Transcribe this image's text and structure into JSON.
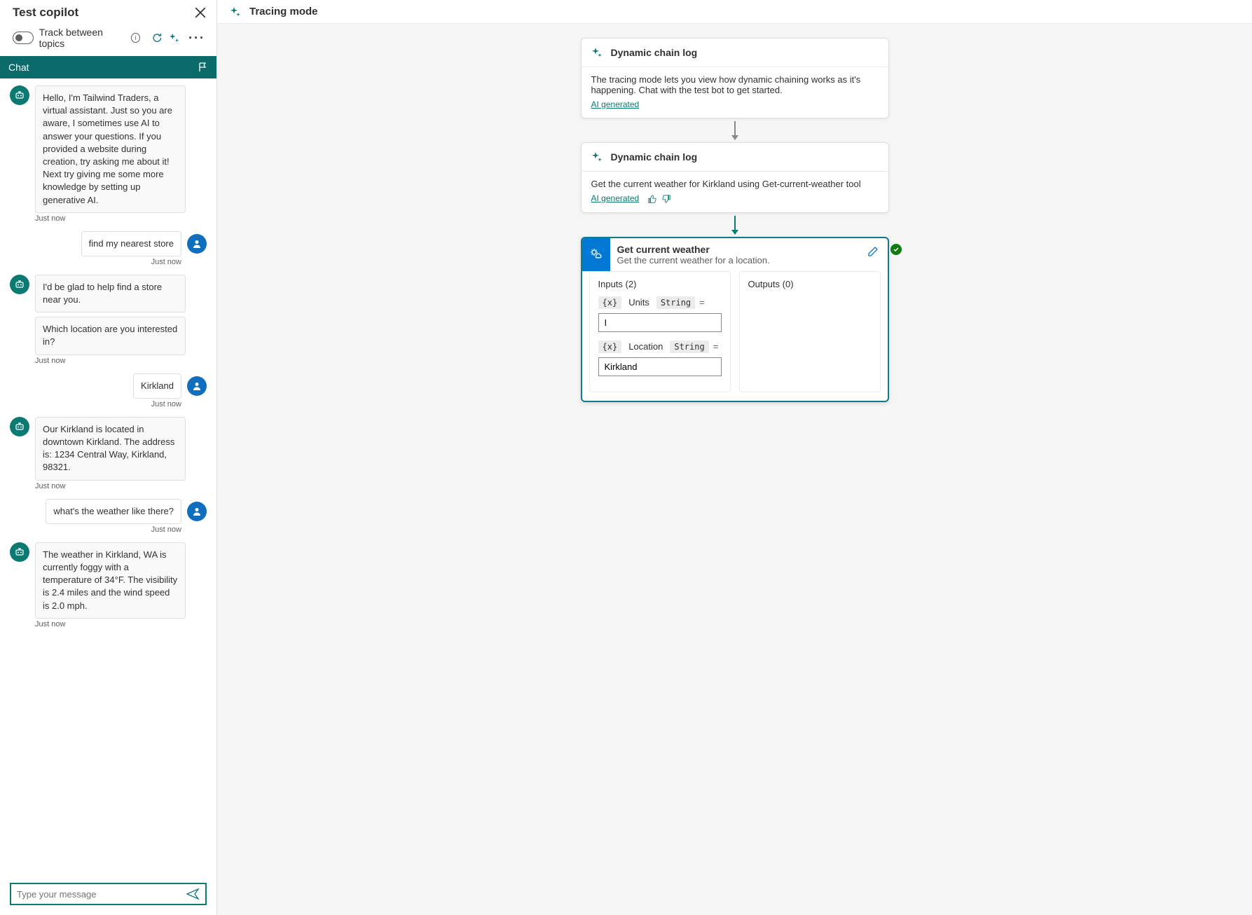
{
  "leftPanel": {
    "title": "Test copilot",
    "trackLabel": "Track between topics",
    "chatTab": "Chat",
    "inputPlaceholder": "Type your message",
    "messages": [
      {
        "role": "bot",
        "texts": [
          "Hello, I'm Tailwind Traders, a virtual assistant. Just so you are aware, I sometimes use AI to answer your questions. If you provided a website during creation, try asking me about it! Next try giving me some more knowledge by setting up generative AI."
        ],
        "time": "Just now"
      },
      {
        "role": "user",
        "texts": [
          "find my nearest store"
        ],
        "time": "Just now"
      },
      {
        "role": "bot",
        "texts": [
          "I'd be glad to help find a store near you.",
          "Which location are you interested in?"
        ],
        "time": "Just now"
      },
      {
        "role": "user",
        "texts": [
          "Kirkland"
        ],
        "time": "Just now"
      },
      {
        "role": "bot",
        "texts": [
          "Our Kirkland is located in downtown Kirkland. The address is: 1234 Central Way, Kirkland, 98321."
        ],
        "time": "Just now"
      },
      {
        "role": "user",
        "texts": [
          "what's the weather like there?"
        ],
        "time": "Just now"
      },
      {
        "role": "bot",
        "texts": [
          "The weather in Kirkland, WA is currently foggy with a temperature of 34°F. The visibility is 2.4 miles and the wind speed is 2.0 mph."
        ],
        "time": "Just now"
      }
    ]
  },
  "rightHeader": {
    "title": "Tracing mode"
  },
  "cards": {
    "log1": {
      "title": "Dynamic chain log",
      "body": "The tracing mode lets you view how dynamic chaining works as it's happening. Chat with the test bot to get started.",
      "aiLink": "AI generated"
    },
    "log2": {
      "title": "Dynamic chain log",
      "body": "Get the current weather for Kirkland using Get-current-weather tool",
      "aiLink": "AI generated"
    },
    "action": {
      "title": "Get current weather",
      "subtitle": "Get the current weather for a location.",
      "inputsLabel": "Inputs (2)",
      "outputsLabel": "Outputs (0)",
      "params": [
        {
          "name": "Units",
          "type": "String",
          "value": "I"
        },
        {
          "name": "Location",
          "type": "String",
          "value": "Kirkland"
        }
      ],
      "varBadge": "{x}"
    }
  }
}
